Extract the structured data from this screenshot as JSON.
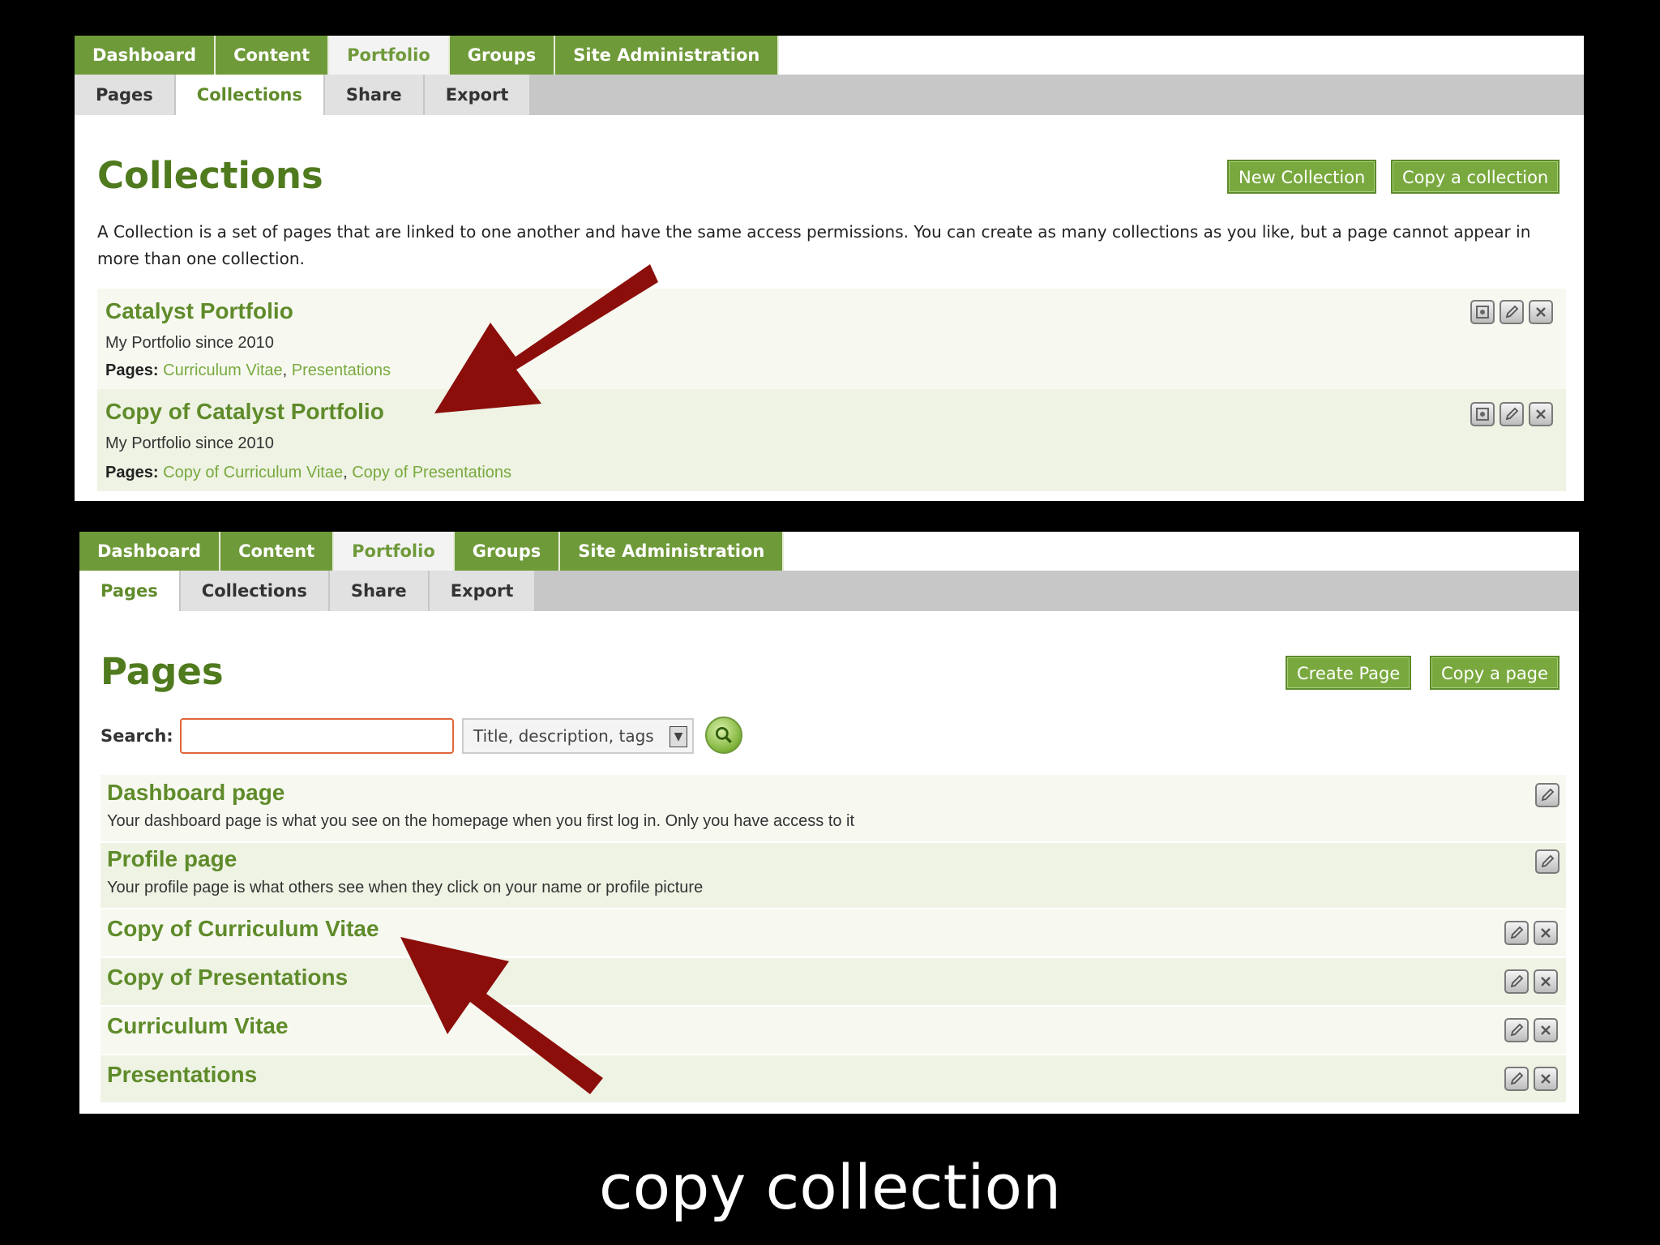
{
  "top": {
    "main_tabs": [
      "Dashboard",
      "Content",
      "Portfolio",
      "Groups",
      "Site Administration"
    ],
    "sub_tabs": [
      "Pages",
      "Collections",
      "Share",
      "Export"
    ],
    "title": "Collections",
    "buttons": {
      "new": "New Collection",
      "copy": "Copy a collection"
    },
    "description": "A Collection is a set of pages that are linked to one another and have the same access permissions. You can create as many collections as you like, but a page cannot appear in more than one collection.",
    "collections": [
      {
        "title": "Catalyst Portfolio",
        "subtitle": "My Portfolio since 2010",
        "pages_label": "Pages:",
        "page1": "Curriculum Vitae",
        "page2": "Presentations"
      },
      {
        "title": "Copy of Catalyst Portfolio",
        "subtitle": "My Portfolio since 2010",
        "pages_label": "Pages:",
        "page1": "Copy of Curriculum Vitae",
        "page2": "Copy of Presentations"
      }
    ]
  },
  "bottom": {
    "main_tabs": [
      "Dashboard",
      "Content",
      "Portfolio",
      "Groups",
      "Site Administration"
    ],
    "sub_tabs": [
      "Pages",
      "Collections",
      "Share",
      "Export"
    ],
    "title": "Pages",
    "buttons": {
      "create": "Create Page",
      "copy": "Copy a page"
    },
    "search": {
      "label": "Search:",
      "value": "",
      "filter": "Title, description, tags"
    },
    "pages": [
      {
        "title": "Dashboard page",
        "desc": "Your dashboard page is what you see on the homepage when you first log in. Only you have access to it"
      },
      {
        "title": "Profile page",
        "desc": "Your profile page is what others see when they click on your name or profile picture"
      },
      {
        "title": "Copy of Curriculum Vitae"
      },
      {
        "title": "Copy of Presentations"
      },
      {
        "title": "Curriculum Vitae"
      },
      {
        "title": "Presentations"
      }
    ]
  },
  "caption": "copy collection",
  "colors": {
    "accent_green": "#6f9a3a",
    "arrow": "#8b0e0a"
  },
  "icons": [
    "config-icon",
    "edit-icon",
    "delete-icon",
    "search-icon",
    "arrow-annotation"
  ]
}
